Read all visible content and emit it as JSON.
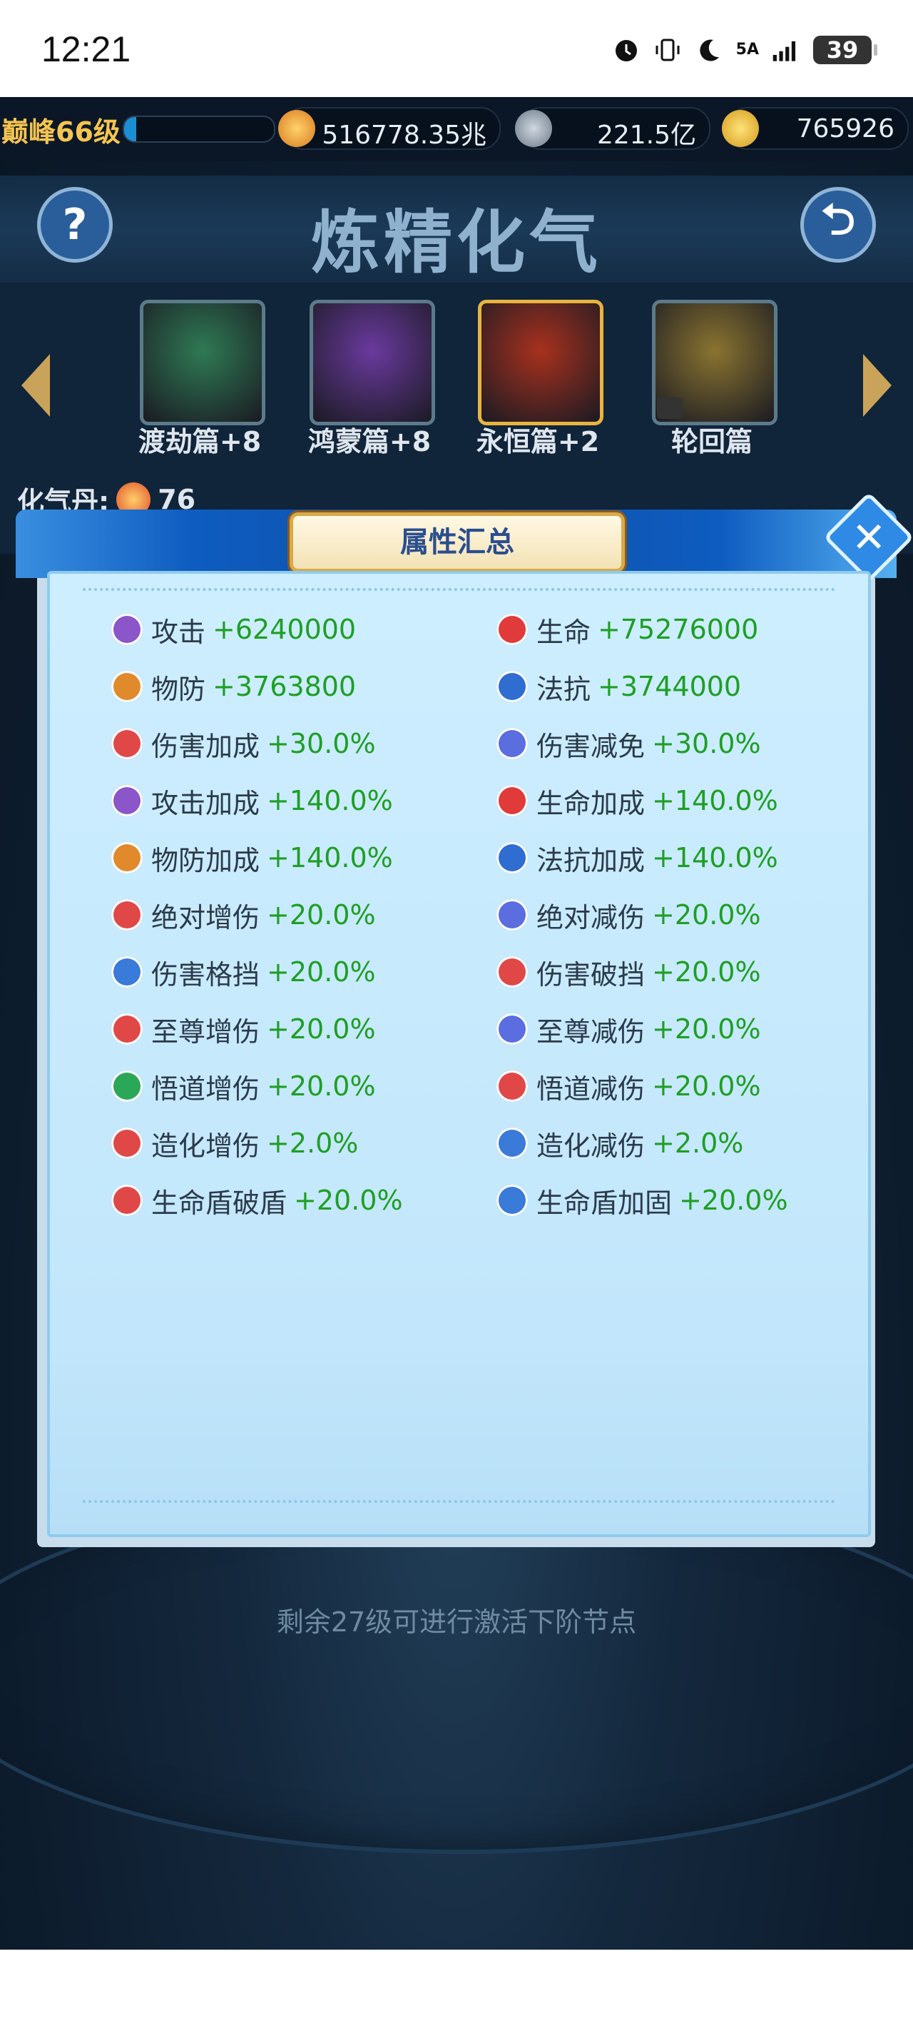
{
  "status_bar": {
    "time": "12:21",
    "network": "5A",
    "battery": "39"
  },
  "top_bar": {
    "level_label": "巅峰66级",
    "exp_fraction": 0.08,
    "currency_1": "516778.35兆",
    "currency_2": "221.5亿",
    "currency_3": "765926"
  },
  "page": {
    "title": "炼精化气",
    "help_label": "?",
    "back_label": "⮌"
  },
  "chapters": [
    {
      "name": "渡劫篇+8",
      "color": "#2f7a55"
    },
    {
      "name": "鸿蒙篇+8",
      "color": "#6a3a9e"
    },
    {
      "name": "永恒篇+2",
      "color": "#a8311e"
    },
    {
      "name": "轮回篇",
      "color": "#8a7430"
    }
  ],
  "qi": {
    "label": "化气丹:",
    "count": "76"
  },
  "bottom_hint": "剩余27级可进行激活下阶节点",
  "dialog": {
    "title": "属性汇总",
    "close_label": "✕",
    "stats_left": [
      {
        "name": "攻击",
        "value": "+6240000",
        "icon": "sword-icon",
        "color": "#8a56c9"
      },
      {
        "name": "物防",
        "value": "+3763800",
        "icon": "shield-icon",
        "color": "#e08a2c"
      },
      {
        "name": "伤害加成",
        "value": "+30.0%",
        "icon": "damage-up-icon",
        "color": "#e04848"
      },
      {
        "name": "攻击加成",
        "value": "+140.0%",
        "icon": "sword-icon",
        "color": "#8a56c9"
      },
      {
        "name": "物防加成",
        "value": "+140.0%",
        "icon": "shield-icon",
        "color": "#e08a2c"
      },
      {
        "name": "绝对增伤",
        "value": "+20.0%",
        "icon": "absolute-damage-icon",
        "color": "#e04848"
      },
      {
        "name": "伤害格挡",
        "value": "+20.0%",
        "icon": "block-icon",
        "color": "#3a7ad8"
      },
      {
        "name": "至尊增伤",
        "value": "+20.0%",
        "icon": "supreme-damage-icon",
        "color": "#e04848"
      },
      {
        "name": "悟道增伤",
        "value": "+20.0%",
        "icon": "yin-yang-icon",
        "color": "#2aa858"
      },
      {
        "name": "造化增伤",
        "value": "+2.0%",
        "icon": "creation-damage-icon",
        "color": "#e04848"
      },
      {
        "name": "生命盾破盾",
        "value": "+20.0%",
        "icon": "shield-break-icon",
        "color": "#e04848"
      }
    ],
    "stats_right": [
      {
        "name": "生命",
        "value": "+75276000",
        "icon": "heart-icon",
        "color": "#e03a3a"
      },
      {
        "name": "法抗",
        "value": "+3744000",
        "icon": "lightning-icon",
        "color": "#2f6ed0"
      },
      {
        "name": "伤害减免",
        "value": "+30.0%",
        "icon": "damage-reduce-icon",
        "color": "#5a6ee0"
      },
      {
        "name": "生命加成",
        "value": "+140.0%",
        "icon": "heart-icon",
        "color": "#e03a3a"
      },
      {
        "name": "法抗加成",
        "value": "+140.0%",
        "icon": "lightning-icon",
        "color": "#2f6ed0"
      },
      {
        "name": "绝对减伤",
        "value": "+20.0%",
        "icon": "absolute-reduce-icon",
        "color": "#5a6ee0"
      },
      {
        "name": "伤害破挡",
        "value": "+20.0%",
        "icon": "break-block-icon",
        "color": "#e04848"
      },
      {
        "name": "至尊减伤",
        "value": "+20.0%",
        "icon": "supreme-reduce-icon",
        "color": "#5a6ee0"
      },
      {
        "name": "悟道减伤",
        "value": "+20.0%",
        "icon": "yin-yang-icon",
        "color": "#e04848"
      },
      {
        "name": "造化减伤",
        "value": "+2.0%",
        "icon": "creation-reduce-icon",
        "color": "#3a7ad8"
      },
      {
        "name": "生命盾加固",
        "value": "+20.0%",
        "icon": "shield-reinforce-icon",
        "color": "#3a7ad8"
      }
    ]
  }
}
